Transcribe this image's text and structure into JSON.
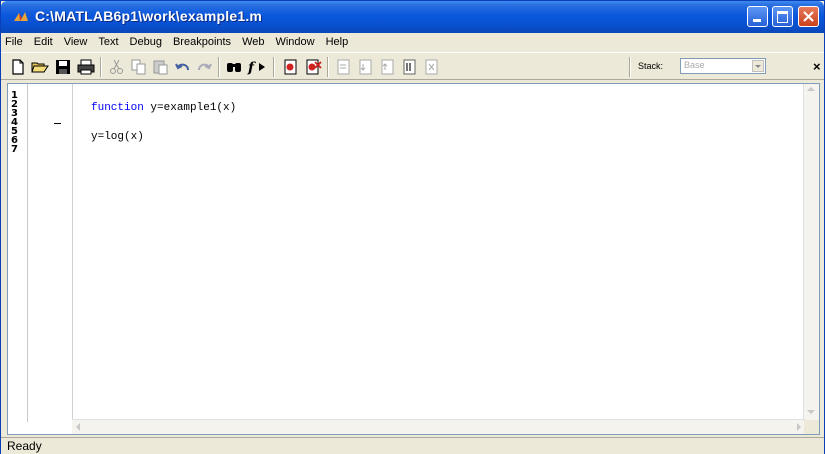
{
  "window": {
    "title": "C:\\MATLAB6p1\\work\\example1.m"
  },
  "menu": [
    "File",
    "Edit",
    "View",
    "Text",
    "Debug",
    "Breakpoints",
    "Web",
    "Window",
    "Help"
  ],
  "toolbar": {
    "icons": [
      "new-file-icon",
      "open-folder-icon",
      "save-icon",
      "print-icon",
      "cut-icon",
      "copy-icon",
      "paste-icon",
      "undo-icon",
      "redo-icon",
      "find-icon",
      "function-icon",
      "set-breakpoint-icon",
      "clear-breakpoint-icon",
      "step-icon",
      "step-in-icon",
      "step-out-icon",
      "continue-icon",
      "exit-debug-icon"
    ],
    "stack_label": "Stack:",
    "stack_value": "Base",
    "close_glyph": "×"
  },
  "editor": {
    "line_numbers": [
      "1",
      "2",
      "3",
      "4",
      "5",
      "6",
      "7"
    ],
    "lines": [
      {
        "keyword": "",
        "text": ""
      },
      {
        "keyword": "function",
        "text": " y=example1(x)"
      },
      {
        "keyword": "",
        "text": ""
      },
      {
        "keyword": "",
        "text": "y=log(x)"
      },
      {
        "keyword": "",
        "text": ""
      },
      {
        "keyword": "",
        "text": ""
      },
      {
        "keyword": "",
        "text": ""
      }
    ],
    "keyword_color": "#0000ff"
  },
  "status": {
    "text": "Ready"
  },
  "colors": {
    "titlebar": "#0a58dd",
    "chrome": "#ece9d8",
    "close_button": "#c8421e"
  }
}
